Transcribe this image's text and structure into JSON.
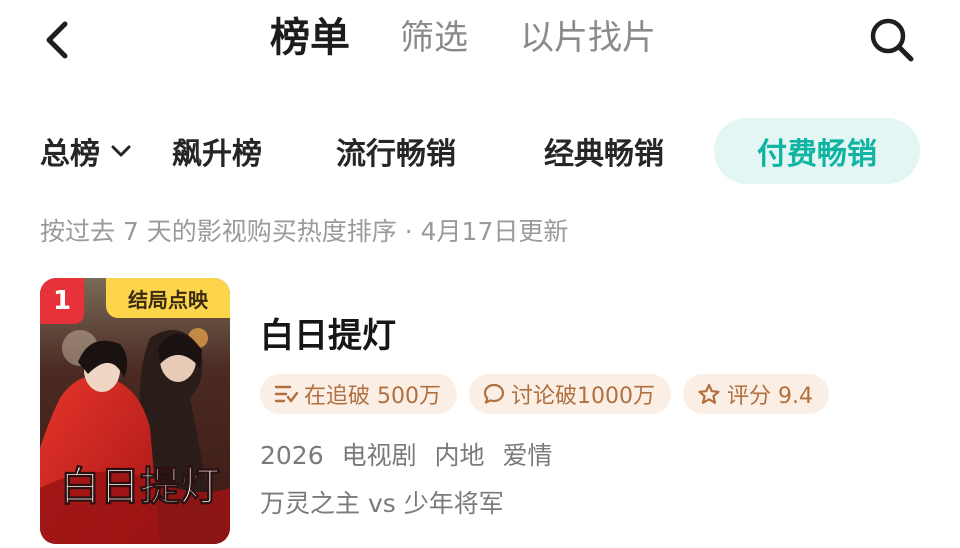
{
  "header": {
    "tabs": [
      {
        "label": "榜单",
        "active": true
      },
      {
        "label": "筛选",
        "active": false
      },
      {
        "label": "以片找片",
        "active": false
      }
    ],
    "back_icon": "chevron-left-icon",
    "search_icon": "search-icon"
  },
  "rank_tabs": {
    "all": {
      "label": "总榜",
      "icon": "chevron-down-icon"
    },
    "items": [
      {
        "label": "飙升榜",
        "active": false
      },
      {
        "label": "流行畅销",
        "active": false
      },
      {
        "label": "经典畅销",
        "active": false
      },
      {
        "label": "付费畅销",
        "active": true
      }
    ],
    "accent_color": "#10b4a2"
  },
  "subtitle": "按过去 7 天的影视购买热度排序 · 4月17日更新",
  "items": [
    {
      "rank": "1",
      "status": "结局点映",
      "title": "白日提灯",
      "chips": [
        {
          "icon": "list-icon",
          "label": "在追破 500万"
        },
        {
          "icon": "chat-icon",
          "label": "讨论破1000万"
        },
        {
          "icon": "star-icon",
          "label": "评分 9.4"
        }
      ],
      "meta": {
        "year": "2026",
        "type": "电视剧",
        "region": "内地",
        "genre": "爱情"
      },
      "description": "万灵之主 vs 少年将军",
      "poster_title": "白日提灯"
    }
  ]
}
